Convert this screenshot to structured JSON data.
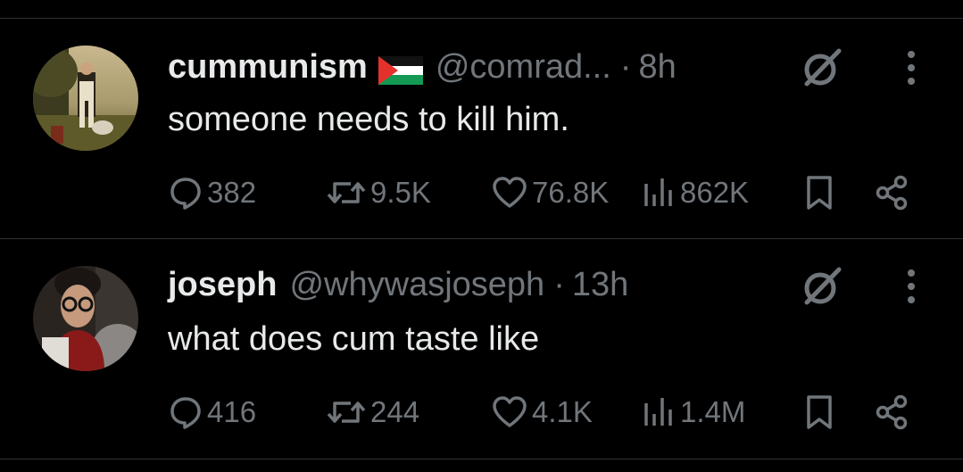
{
  "tweets": [
    {
      "name": "cummunism",
      "flag": "palestine-flag",
      "handle": "@comrad...",
      "dot": "·",
      "time": "8h",
      "text": "someone needs to kill him.",
      "replies": "382",
      "reposts": "9.5K",
      "likes": "76.8K",
      "views": "862K"
    },
    {
      "name": "joseph",
      "handle": "@whywasjoseph",
      "dot": "·",
      "time": "13h",
      "text": "what does cum taste like",
      "replies": "416",
      "reposts": "244",
      "likes": "4.1K",
      "views": "1.4M"
    }
  ],
  "colors": {
    "background": "#000000",
    "text": "#e7e9ea",
    "muted": "#71767b",
    "divider": "#2f3336"
  }
}
